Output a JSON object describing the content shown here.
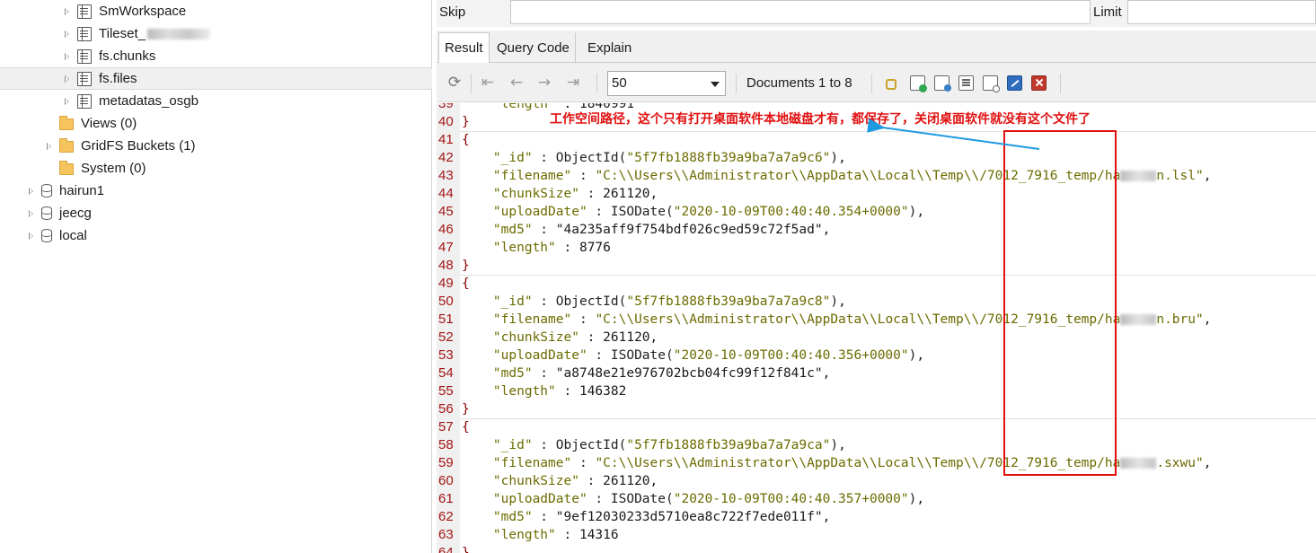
{
  "tree": {
    "items": [
      {
        "label": "SmWorkspace",
        "icon": "collection-icon",
        "expandable": true
      },
      {
        "label": "Tileset_",
        "icon": "collection-icon",
        "expandable": true,
        "blurred_suffix": true
      },
      {
        "label": "fs.chunks",
        "icon": "collection-icon",
        "expandable": true
      },
      {
        "label": "fs.files",
        "icon": "collection-icon",
        "expandable": true,
        "selected": true
      },
      {
        "label": "metadatas_osgb",
        "icon": "collection-icon",
        "expandable": true
      },
      {
        "label": "Views (0)",
        "icon": "folder-icon",
        "expandable": false
      },
      {
        "label": "GridFS Buckets (1)",
        "icon": "folder-icon",
        "expandable": true
      },
      {
        "label": "System (0)",
        "icon": "folder-icon",
        "expandable": false
      },
      {
        "label": "hairun1",
        "icon": "database-icon",
        "expandable": true
      },
      {
        "label": "jeecg",
        "icon": "database-icon",
        "expandable": true
      },
      {
        "label": "local",
        "icon": "database-icon",
        "expandable": true
      }
    ]
  },
  "query": {
    "skip_label": "Skip",
    "skip_value": "",
    "limit_label": "Limit",
    "limit_value": ""
  },
  "tabs": [
    {
      "label": "Result",
      "active": true
    },
    {
      "label": "Query Code",
      "active": false
    },
    {
      "label": "Explain",
      "active": false
    }
  ],
  "toolbar": {
    "page_size": "50",
    "docs_label": "Documents 1 to 8"
  },
  "code": {
    "lines": [
      {
        "n": "39",
        "text": "    \"length\" : 1840991",
        "partial": true
      },
      {
        "n": "40",
        "text": "}"
      },
      {
        "n": "41",
        "text": "{"
      },
      {
        "n": "42",
        "text": "    \"_id\" : ObjectId(\"5f7fb1888fb39a9ba7a7a9c6\"),"
      },
      {
        "n": "43",
        "text": "    \"filename\" : \"C:\\\\Users\\\\Administrator\\\\AppData\\\\Local\\\\Temp\\\\/7012_7916_temp/ha",
        "blur_after": true,
        "tail": "n.lsl\","
      },
      {
        "n": "44",
        "text": "    \"chunkSize\" : 261120,"
      },
      {
        "n": "45",
        "text": "    \"uploadDate\" : ISODate(\"2020-10-09T00:40:40.354+0000\"),"
      },
      {
        "n": "46",
        "text": "    \"md5\" : \"4a235aff9f754bdf026c9ed59c72f5ad\","
      },
      {
        "n": "47",
        "text": "    \"length\" : 8776"
      },
      {
        "n": "48",
        "text": "}"
      },
      {
        "n": "49",
        "text": "{"
      },
      {
        "n": "50",
        "text": "    \"_id\" : ObjectId(\"5f7fb1888fb39a9ba7a7a9c8\"),"
      },
      {
        "n": "51",
        "text": "    \"filename\" : \"C:\\\\Users\\\\Administrator\\\\AppData\\\\Local\\\\Temp\\\\/7012_7916_temp/ha",
        "blur_after": true,
        "tail": "n.bru\","
      },
      {
        "n": "52",
        "text": "    \"chunkSize\" : 261120,"
      },
      {
        "n": "53",
        "text": "    \"uploadDate\" : ISODate(\"2020-10-09T00:40:40.356+0000\"),"
      },
      {
        "n": "54",
        "text": "    \"md5\" : \"a8748e21e976702bcb04fc99f12f841c\","
      },
      {
        "n": "55",
        "text": "    \"length\" : 146382"
      },
      {
        "n": "56",
        "text": "}"
      },
      {
        "n": "57",
        "text": "{"
      },
      {
        "n": "58",
        "text": "    \"_id\" : ObjectId(\"5f7fb1888fb39a9ba7a7a9ca\"),"
      },
      {
        "n": "59",
        "text": "    \"filename\" : \"C:\\\\Users\\\\Administrator\\\\AppData\\\\Local\\\\Temp\\\\/7012_7916_temp/ha",
        "blur_after": true,
        "tail": ".sxwu\","
      },
      {
        "n": "60",
        "text": "    \"chunkSize\" : 261120,"
      },
      {
        "n": "61",
        "text": "    \"uploadDate\" : ISODate(\"2020-10-09T00:40:40.357+0000\"),"
      },
      {
        "n": "62",
        "text": "    \"md5\" : \"9ef12030233d5710ea8c722f7ede011f\","
      },
      {
        "n": "63",
        "text": "    \"length\" : 14316"
      },
      {
        "n": "64",
        "text": "}",
        "partial": true
      }
    ]
  },
  "annotation": {
    "text": "工作空间路径，这个只有打开桌面软件本地磁盘才有，都保存了，关闭桌面软件就没有这个文件了",
    "color": "#e01010",
    "arrow_color": "#1e9be0"
  }
}
